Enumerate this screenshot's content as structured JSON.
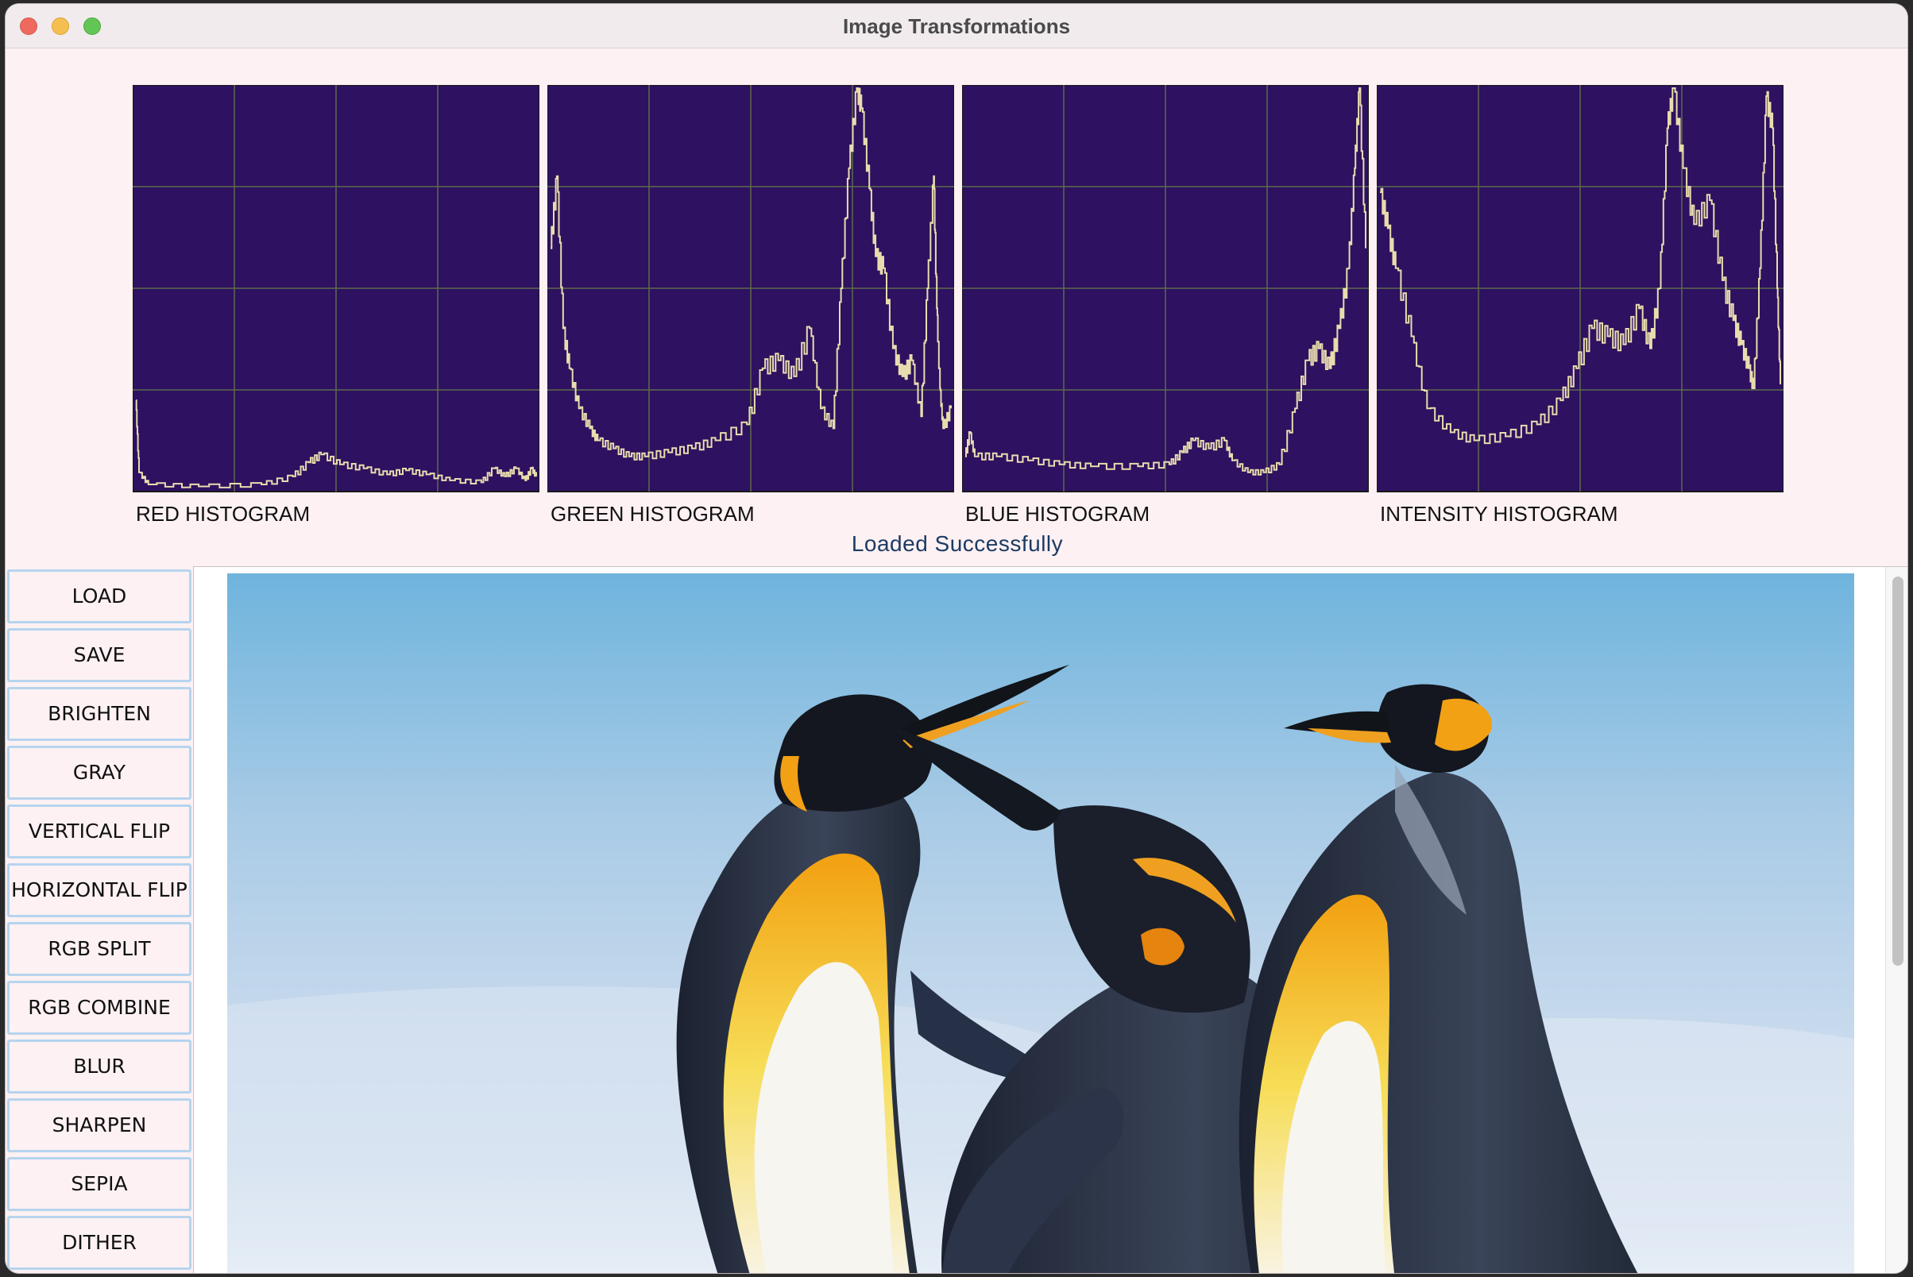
{
  "window": {
    "title": "Image Transformations"
  },
  "histograms": [
    {
      "label": "RED HISTOGRAM",
      "id": "red"
    },
    {
      "label": "GREEN HISTOGRAM",
      "id": "green"
    },
    {
      "label": "BLUE HISTOGRAM",
      "id": "blue"
    },
    {
      "label": "INTENSITY HISTOGRAM",
      "id": "intensity"
    }
  ],
  "status": "Loaded Successfully",
  "buttons": [
    "LOAD",
    "SAVE",
    "BRIGHTEN",
    "GRAY",
    "VERTICAL FLIP",
    "HORIZONTAL FLIP",
    "RGB SPLIT",
    "RGB COMBINE",
    "BLUR",
    "SHARPEN",
    "SEPIA",
    "DITHER"
  ],
  "colors": {
    "plot_background": "#2e1160",
    "plot_line": "#e8dcae",
    "grid": "#5d6a4c",
    "window_background": "#fdf1f3",
    "button_border": "#b6d4ee",
    "status_text": "#1d3a63"
  },
  "chart_data": [
    {
      "type": "line",
      "label": "RED HISTOGRAM",
      "xlim": [
        0,
        255
      ],
      "ylim": [
        0,
        1
      ],
      "points": [
        [
          0,
          0.22
        ],
        [
          2,
          0.04
        ],
        [
          8,
          0.01
        ],
        [
          40,
          0.005
        ],
        [
          80,
          0.01
        ],
        [
          100,
          0.03
        ],
        [
          110,
          0.065
        ],
        [
          118,
          0.085
        ],
        [
          130,
          0.06
        ],
        [
          145,
          0.05
        ],
        [
          160,
          0.035
        ],
        [
          172,
          0.045
        ],
        [
          185,
          0.035
        ],
        [
          200,
          0.02
        ],
        [
          220,
          0.015
        ],
        [
          228,
          0.05
        ],
        [
          235,
          0.03
        ],
        [
          242,
          0.05
        ],
        [
          248,
          0.02
        ],
        [
          252,
          0.05
        ],
        [
          255,
          0.03
        ]
      ]
    },
    {
      "type": "line",
      "label": "GREEN HISTOGRAM",
      "xlim": [
        0,
        255
      ],
      "ylim": [
        0,
        1
      ],
      "points": [
        [
          0,
          0.6
        ],
        [
          4,
          0.78
        ],
        [
          8,
          0.4
        ],
        [
          12,
          0.3
        ],
        [
          18,
          0.2
        ],
        [
          25,
          0.15
        ],
        [
          30,
          0.12
        ],
        [
          40,
          0.1
        ],
        [
          50,
          0.08
        ],
        [
          60,
          0.08
        ],
        [
          75,
          0.09
        ],
        [
          90,
          0.1
        ],
        [
          105,
          0.12
        ],
        [
          125,
          0.16
        ],
        [
          135,
          0.3
        ],
        [
          145,
          0.32
        ],
        [
          155,
          0.28
        ],
        [
          165,
          0.4
        ],
        [
          172,
          0.2
        ],
        [
          180,
          0.15
        ],
        [
          185,
          0.5
        ],
        [
          190,
          0.8
        ],
        [
          195,
          1.0
        ],
        [
          198,
          0.95
        ],
        [
          203,
          0.75
        ],
        [
          207,
          0.58
        ],
        [
          212,
          0.55
        ],
        [
          218,
          0.35
        ],
        [
          224,
          0.28
        ],
        [
          230,
          0.32
        ],
        [
          236,
          0.18
        ],
        [
          240,
          0.5
        ],
        [
          244,
          0.78
        ],
        [
          246,
          0.45
        ],
        [
          248,
          0.25
        ],
        [
          250,
          0.15
        ],
        [
          255,
          0.2
        ]
      ]
    },
    {
      "type": "line",
      "label": "BLUE HISTOGRAM",
      "xlim": [
        0,
        255
      ],
      "ylim": [
        0,
        1
      ],
      "points": [
        [
          0,
          0.08
        ],
        [
          3,
          0.14
        ],
        [
          6,
          0.08
        ],
        [
          20,
          0.08
        ],
        [
          40,
          0.07
        ],
        [
          60,
          0.06
        ],
        [
          80,
          0.055
        ],
        [
          110,
          0.055
        ],
        [
          130,
          0.06
        ],
        [
          138,
          0.09
        ],
        [
          145,
          0.12
        ],
        [
          155,
          0.1
        ],
        [
          165,
          0.12
        ],
        [
          170,
          0.07
        ],
        [
          180,
          0.04
        ],
        [
          190,
          0.04
        ],
        [
          200,
          0.06
        ],
        [
          210,
          0.2
        ],
        [
          218,
          0.32
        ],
        [
          225,
          0.35
        ],
        [
          232,
          0.3
        ],
        [
          238,
          0.4
        ],
        [
          244,
          0.55
        ],
        [
          248,
          0.8
        ],
        [
          251,
          1.0
        ],
        [
          255,
          0.6
        ]
      ]
    },
    {
      "type": "line",
      "label": "INTENSITY HISTOGRAM",
      "xlim": [
        0,
        255
      ],
      "ylim": [
        0,
        1
      ],
      "points": [
        [
          0,
          0.74
        ],
        [
          5,
          0.65
        ],
        [
          10,
          0.55
        ],
        [
          20,
          0.38
        ],
        [
          30,
          0.2
        ],
        [
          45,
          0.14
        ],
        [
          60,
          0.12
        ],
        [
          80,
          0.13
        ],
        [
          100,
          0.16
        ],
        [
          115,
          0.22
        ],
        [
          125,
          0.3
        ],
        [
          135,
          0.4
        ],
        [
          145,
          0.38
        ],
        [
          155,
          0.36
        ],
        [
          165,
          0.45
        ],
        [
          172,
          0.35
        ],
        [
          178,
          0.5
        ],
        [
          183,
          0.9
        ],
        [
          187,
          1.0
        ],
        [
          193,
          0.8
        ],
        [
          200,
          0.66
        ],
        [
          210,
          0.72
        ],
        [
          218,
          0.52
        ],
        [
          225,
          0.42
        ],
        [
          230,
          0.36
        ],
        [
          235,
          0.3
        ],
        [
          238,
          0.25
        ],
        [
          242,
          0.55
        ],
        [
          246,
          0.98
        ],
        [
          250,
          0.9
        ],
        [
          253,
          0.5
        ],
        [
          255,
          0.26
        ]
      ]
    }
  ]
}
